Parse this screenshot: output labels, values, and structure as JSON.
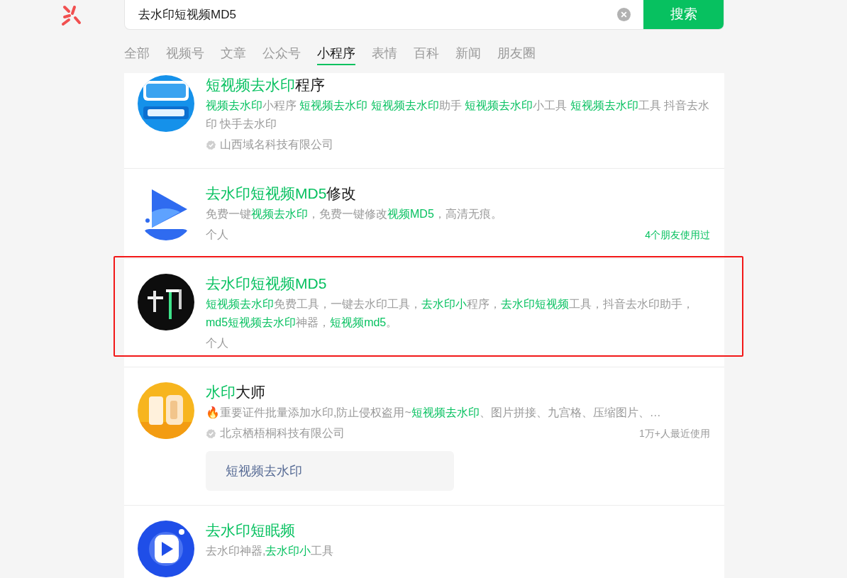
{
  "search": {
    "value": "去水印短视频MD5",
    "button": "搜索"
  },
  "tabs": [
    {
      "label": "全部",
      "selected": false
    },
    {
      "label": "视频号",
      "selected": false
    },
    {
      "label": "文章",
      "selected": false
    },
    {
      "label": "公众号",
      "selected": false
    },
    {
      "label": "小程序",
      "selected": true
    },
    {
      "label": "表情",
      "selected": false
    },
    {
      "label": "百科",
      "selected": false
    },
    {
      "label": "新闻",
      "selected": false
    },
    {
      "label": "朋友圈",
      "selected": false
    }
  ],
  "results": [
    {
      "title": [
        {
          "t": "短视频去水印",
          "hl": true
        },
        {
          "t": "程序",
          "hl": false
        }
      ],
      "description": [
        {
          "t": "视频去水印",
          "hl": true
        },
        {
          "t": "小程序 ",
          "hl": false
        },
        {
          "t": "短视频去水印 ",
          "hl": true
        },
        {
          "t": "短视频去水印",
          "hl": true
        },
        {
          "t": "助手 ",
          "hl": false
        },
        {
          "t": "短视频去水印",
          "hl": true
        },
        {
          "t": "小工具 ",
          "hl": false
        },
        {
          "t": "短视频去水印",
          "hl": true
        },
        {
          "t": "工具 抖音去水印 快手去水印",
          "hl": false
        }
      ],
      "owner": "山西域名科技有限公司",
      "verified": true,
      "outlined": false
    },
    {
      "title": [
        {
          "t": "去水印短视频MD5",
          "hl": true
        },
        {
          "t": "修改",
          "hl": false
        }
      ],
      "description": [
        {
          "t": "免费一键",
          "hl": false
        },
        {
          "t": "视频去水印",
          "hl": true
        },
        {
          "t": "，免费一键修改",
          "hl": false
        },
        {
          "t": "视频MD5",
          "hl": true
        },
        {
          "t": "，高清无痕。",
          "hl": false
        }
      ],
      "owner": "个人",
      "verified": false,
      "usage": {
        "text": "4个朋友使用过",
        "hl": true
      },
      "outlined": false
    },
    {
      "title": [
        {
          "t": "去水印短视频MD5",
          "hl": true
        }
      ],
      "description": [
        {
          "t": "短视频去水印",
          "hl": true
        },
        {
          "t": "免费工具，一键去水印工具，",
          "hl": false
        },
        {
          "t": "去水印小",
          "hl": true
        },
        {
          "t": "程序，",
          "hl": false
        },
        {
          "t": "去水印短视频",
          "hl": true
        },
        {
          "t": "工具，抖音去水印助手，",
          "hl": false
        },
        {
          "t": "md5短视频去水印",
          "hl": true
        },
        {
          "t": "神器，",
          "hl": false
        },
        {
          "t": "短视频md5",
          "hl": true
        },
        {
          "t": "。",
          "hl": false
        }
      ],
      "owner": "个人",
      "verified": false,
      "outlined": true
    },
    {
      "title": [
        {
          "t": "水印",
          "hl": true
        },
        {
          "t": "大师",
          "hl": false
        }
      ],
      "description": [
        {
          "t": "🔥重要证件批量添加水印,防止侵权盗用~",
          "hl": false
        },
        {
          "t": "短视频去水印",
          "hl": true
        },
        {
          "t": "、图片拼接、九宫格、压缩图片、…",
          "hl": false
        }
      ],
      "owner": "北京栖梧桐科技有限公司",
      "verified": true,
      "usage": {
        "text": "1万+人最近使用",
        "hl": false
      },
      "service": "短视频去水印",
      "outlined": false
    },
    {
      "title": [
        {
          "t": "去水印短眠频",
          "hl": true
        }
      ],
      "description": [
        {
          "t": "去水印神器,",
          "hl": false
        },
        {
          "t": "去水印小",
          "hl": true
        },
        {
          "t": "工具",
          "hl": false
        }
      ],
      "outlined": false
    }
  ]
}
